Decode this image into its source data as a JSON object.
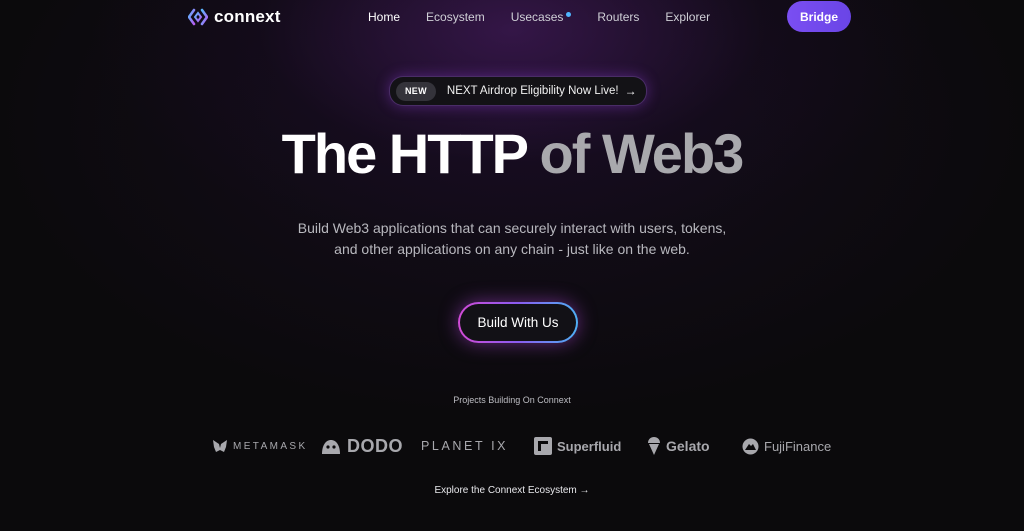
{
  "header": {
    "logo_text": "connext",
    "nav": [
      {
        "label": "Home",
        "active": true
      },
      {
        "label": "Ecosystem"
      },
      {
        "label": "Usecases"
      },
      {
        "label": "Routers"
      },
      {
        "label": "Explorer"
      }
    ],
    "bridge_label": "Bridge"
  },
  "announcement": {
    "badge": "NEW",
    "text": "NEXT Airdrop Eligibility Now Live!",
    "arrow": "→"
  },
  "hero": {
    "title_part1": "The HTTP",
    "title_part2": "of Web3",
    "subtitle_line1": "Build Web3 applications that can securely interact with users, tokens,",
    "subtitle_line2": "and other applications on any chain - just like on the web.",
    "cta_label": "Build With Us"
  },
  "partners": {
    "label": "Projects Building On Connext",
    "items": [
      {
        "name": "METAMASK",
        "icon": "metamask-icon"
      },
      {
        "name": "DODO",
        "icon": "dodo-icon"
      },
      {
        "name": "PLANET IX",
        "icon": ""
      },
      {
        "name": "Superfluid",
        "icon": "superfluid-icon"
      },
      {
        "name": "Gelato",
        "icon": "gelato-icon"
      },
      {
        "name": "FujiFinance",
        "icon": "fuji-icon"
      }
    ]
  },
  "explore_link": "Explore the Connext Ecosystem →",
  "colors": {
    "background": "#0b0a0c",
    "accent": "#7a4ef2",
    "dot": "#4fb6ff",
    "muted_text": "#a9a9ad"
  }
}
